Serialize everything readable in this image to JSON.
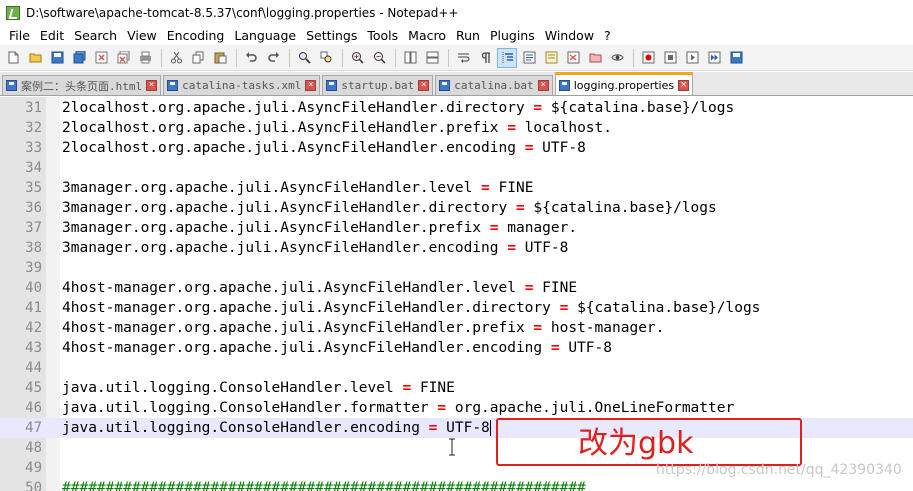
{
  "window": {
    "title": "D:\\software\\apache-tomcat-8.5.37\\conf\\logging.properties - Notepad++"
  },
  "menu": [
    "File",
    "Edit",
    "Search",
    "View",
    "Encoding",
    "Language",
    "Settings",
    "Tools",
    "Macro",
    "Run",
    "Plugins",
    "Window",
    "?"
  ],
  "toolbar": {
    "buttons": [
      "new-file",
      "open-file",
      "save",
      "save-all",
      "close",
      "close-all",
      "print",
      "cut",
      "copy",
      "paste",
      "undo",
      "redo",
      "find",
      "replace",
      "zoom-in",
      "zoom-out",
      "sync-v",
      "sync-h",
      "word-wrap",
      "all-chars",
      "indent-guide",
      "udl",
      "doc-map",
      "function-list",
      "folder",
      "monitor",
      "record-macro",
      "stop-record",
      "play-macro",
      "play-multi",
      "save-macro"
    ]
  },
  "tabs": [
    {
      "label": "案例二：头条页面.html",
      "active": false
    },
    {
      "label": "catalina-tasks.xml",
      "active": false
    },
    {
      "label": "startup.bat",
      "active": false
    },
    {
      "label": "catalina.bat",
      "active": false
    },
    {
      "label": "logging.properties",
      "active": true
    }
  ],
  "editor": {
    "lines": [
      {
        "n": "31",
        "key": "2localhost.org.apache.juli.AsyncFileHandler.directory",
        "value": "${catalina.base}/logs"
      },
      {
        "n": "32",
        "key": "2localhost.org.apache.juli.AsyncFileHandler.prefix",
        "value": "localhost."
      },
      {
        "n": "33",
        "key": "2localhost.org.apache.juli.AsyncFileHandler.encoding",
        "value": "UTF-8"
      },
      {
        "n": "34",
        "key": "",
        "value": ""
      },
      {
        "n": "35",
        "key": "3manager.org.apache.juli.AsyncFileHandler.level",
        "value": "FINE"
      },
      {
        "n": "36",
        "key": "3manager.org.apache.juli.AsyncFileHandler.directory",
        "value": "${catalina.base}/logs"
      },
      {
        "n": "37",
        "key": "3manager.org.apache.juli.AsyncFileHandler.prefix",
        "value": "manager."
      },
      {
        "n": "38",
        "key": "3manager.org.apache.juli.AsyncFileHandler.encoding",
        "value": "UTF-8"
      },
      {
        "n": "39",
        "key": "",
        "value": ""
      },
      {
        "n": "40",
        "key": "4host-manager.org.apache.juli.AsyncFileHandler.level",
        "value": "FINE"
      },
      {
        "n": "41",
        "key": "4host-manager.org.apache.juli.AsyncFileHandler.directory",
        "value": "${catalina.base}/logs"
      },
      {
        "n": "42",
        "key": "4host-manager.org.apache.juli.AsyncFileHandler.prefix",
        "value": "host-manager."
      },
      {
        "n": "43",
        "key": "4host-manager.org.apache.juli.AsyncFileHandler.encoding",
        "value": "UTF-8"
      },
      {
        "n": "44",
        "key": "",
        "value": ""
      },
      {
        "n": "45",
        "key": "java.util.logging.ConsoleHandler.level",
        "value": "FINE"
      },
      {
        "n": "46",
        "key": "java.util.logging.ConsoleHandler.formatter",
        "value": "org.apache.juli.OneLineFormatter"
      },
      {
        "n": "47",
        "key": "java.util.logging.ConsoleHandler.encoding",
        "value": "UTF-8",
        "current": true
      },
      {
        "n": "48",
        "key": "",
        "value": ""
      },
      {
        "n": "49",
        "key": "",
        "value": ""
      },
      {
        "n": "50",
        "key": "",
        "value": "",
        "comment": "############################################################"
      }
    ]
  },
  "annotation": {
    "text": "改为gbk"
  },
  "watermark": "https://blog.csdn.net/qq_42390340",
  "colors": {
    "equals": "#ff0000",
    "comment": "#008000",
    "annotation": "#e0201c",
    "active_tab_accent": "#f5a623"
  }
}
